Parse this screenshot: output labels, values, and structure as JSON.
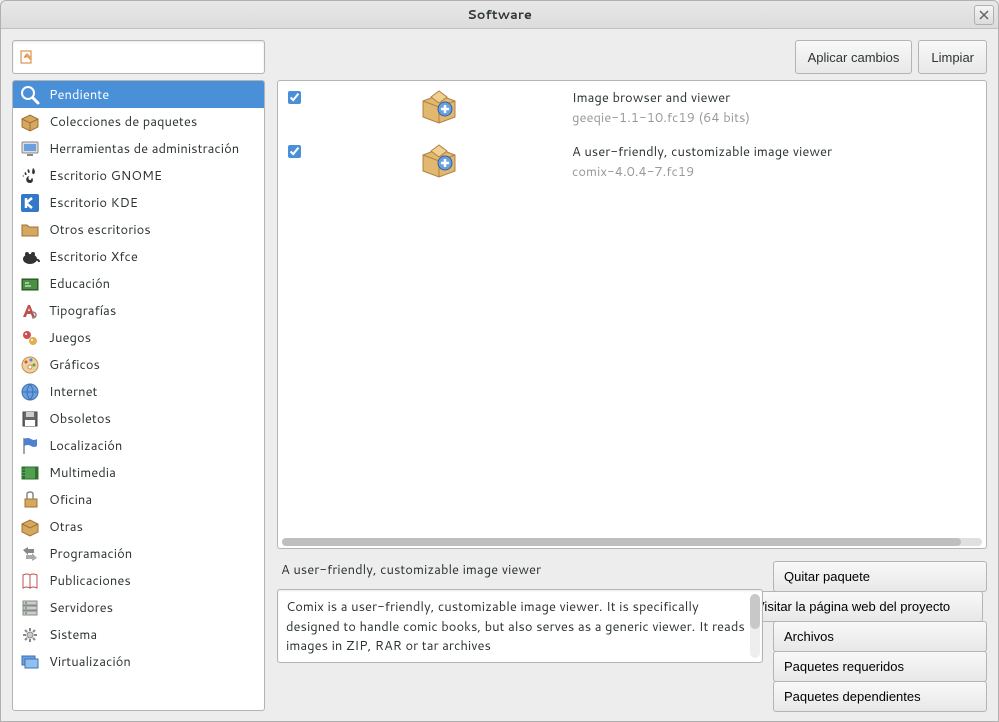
{
  "window": {
    "title": "Software"
  },
  "toolbar": {
    "apply_label": "Aplicar cambios",
    "clear_label": "Limpiar"
  },
  "sidebar": {
    "search_placeholder": "",
    "categories": [
      {
        "label": "Pendiente",
        "icon": "search",
        "selected": true
      },
      {
        "label": "Colecciones de paquetes",
        "icon": "box"
      },
      {
        "label": "Herramientas de administración",
        "icon": "monitor"
      },
      {
        "label": "Escritorio GNOME",
        "icon": "gnome"
      },
      {
        "label": "Escritorio KDE",
        "icon": "kde"
      },
      {
        "label": "Otros escritorios",
        "icon": "folder"
      },
      {
        "label": "Escritorio Xfce",
        "icon": "xfce"
      },
      {
        "label": "Educación",
        "icon": "education"
      },
      {
        "label": "Tipografías",
        "icon": "font"
      },
      {
        "label": "Juegos",
        "icon": "games"
      },
      {
        "label": "Gráficos",
        "icon": "graphics"
      },
      {
        "label": "Internet",
        "icon": "internet"
      },
      {
        "label": "Obsoletos",
        "icon": "floppy"
      },
      {
        "label": "Localización",
        "icon": "flag"
      },
      {
        "label": "Multimedia",
        "icon": "multimedia"
      },
      {
        "label": "Oficina",
        "icon": "office"
      },
      {
        "label": "Otras",
        "icon": "other"
      },
      {
        "label": "Programación",
        "icon": "dev"
      },
      {
        "label": "Publicaciones",
        "icon": "book"
      },
      {
        "label": "Servidores",
        "icon": "server"
      },
      {
        "label": "Sistema",
        "icon": "system"
      },
      {
        "label": "Virtualización",
        "icon": "virtual"
      }
    ]
  },
  "packages": [
    {
      "checked": true,
      "description": "A user-friendly, customizable image viewer",
      "version": "comix-4.0.4-7.fc19"
    },
    {
      "checked": true,
      "description": "Image browser and viewer",
      "version": "geeqie-1.1-10.fc19 (64 bits)"
    }
  ],
  "detail": {
    "title": "A user-friendly, customizable image viewer",
    "body": "Comix is a user-friendly, customizable image viewer. It is specifically designed to handle comic books, but also serves as a generic viewer. It reads images in ZIP, RAR or tar archives",
    "buttons": {
      "remove": "Quitar paquete",
      "visit": "Visitar la página web del proyecto",
      "files": "Archivos",
      "required": "Paquetes requeridos",
      "dependent": "Paquetes dependientes"
    }
  }
}
